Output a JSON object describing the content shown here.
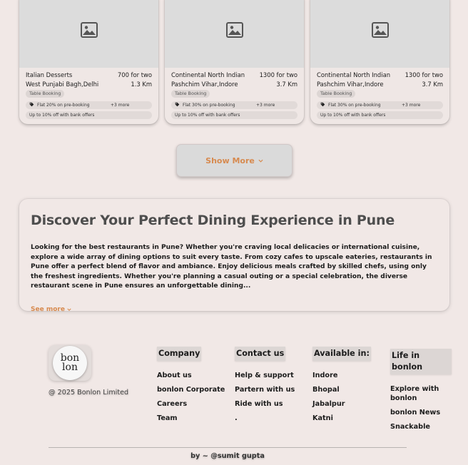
{
  "cards": [
    {
      "cuisine": "Italian Desserts",
      "price": "700 for two",
      "location": "West Punjabi Bagh,Delhi",
      "distance": "1.3 Km",
      "tag": "Table Booking",
      "offer": "Flat 20% on pre-booking",
      "more": "+3 more",
      "bank_offer": "Up to 10% off with bank offers"
    },
    {
      "cuisine": "Continental North Indian",
      "price": "1300 for two",
      "location": "Pashchim Vihar,Indore",
      "distance": "3.7 Km",
      "tag": "Table Booking",
      "offer": "Flat 30% on pre-booking",
      "more": "+3 more",
      "bank_offer": "Up to 10% off with bank offers"
    },
    {
      "cuisine": "Continental North Indian",
      "price": "1300 for two",
      "location": "Pashchim Vihar,Indore",
      "distance": "3.7 Km",
      "tag": "Table Booking",
      "offer": "Flat 30% on pre-booking",
      "more": "+3 more",
      "bank_offer": "Up to 10% off with bank offers"
    }
  ],
  "show_more": {
    "label": "Show More"
  },
  "discover": {
    "title": "Discover Your Perfect Dining Experience in Pune",
    "body": "Looking for the best restaurants in Pune? Whether you're craving local delicacies or international cuisine, explore a wide array of dining options to suit every taste. From cozy cafes to upscale eateries, restaurants in Pune offer a perfect blend of flavor and ambiance. Enjoy delicious meals crafted by skilled chefs, using only the freshest ingredients. Whether you're planning a casual outing or a special celebration, the diverse restaurant scene in Pune ensures an unforgettable dining...",
    "see_more": "See more"
  },
  "footer": {
    "logo_top": "bon",
    "logo_bottom": "lon",
    "copyright": "@ 2025 Bonlon Limited",
    "columns": [
      {
        "title": "Company",
        "items": [
          "About us",
          "bonlon Corporate",
          "Careers",
          "Team"
        ]
      },
      {
        "title": "Contact us",
        "items": [
          "Help & support",
          "Partern with us",
          "Ride with us",
          "."
        ]
      },
      {
        "title": "Available in:",
        "items": [
          "Indore",
          "Bhopal",
          "Jabalpur",
          "Katni"
        ]
      },
      {
        "title": "Life in bonlon",
        "items": [
          "Explore with bonlon",
          "bonlon News",
          "Snackable"
        ]
      }
    ],
    "byline": "by ~ @sumit gupta"
  },
  "colors": {
    "accent": "#d78a4f",
    "background": "#f1e8e6",
    "card_image": "#dcdcdc"
  },
  "icons": {
    "image_placeholder": "image-icon",
    "offer": "tag-icon",
    "chevron": "chevron-down-icon"
  }
}
